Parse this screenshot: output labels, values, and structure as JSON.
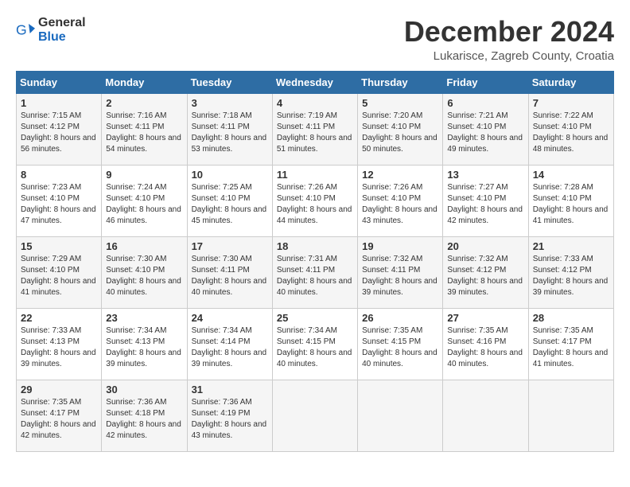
{
  "logo": {
    "text_general": "General",
    "text_blue": "Blue"
  },
  "title": "December 2024",
  "subtitle": "Lukarisce, Zagreb County, Croatia",
  "days_of_week": [
    "Sunday",
    "Monday",
    "Tuesday",
    "Wednesday",
    "Thursday",
    "Friday",
    "Saturday"
  ],
  "weeks": [
    [
      {
        "day": 1,
        "sunrise": "7:15 AM",
        "sunset": "4:12 PM",
        "daylight": "8 hours and 56 minutes."
      },
      {
        "day": 2,
        "sunrise": "7:16 AM",
        "sunset": "4:11 PM",
        "daylight": "8 hours and 54 minutes."
      },
      {
        "day": 3,
        "sunrise": "7:18 AM",
        "sunset": "4:11 PM",
        "daylight": "8 hours and 53 minutes."
      },
      {
        "day": 4,
        "sunrise": "7:19 AM",
        "sunset": "4:11 PM",
        "daylight": "8 hours and 51 minutes."
      },
      {
        "day": 5,
        "sunrise": "7:20 AM",
        "sunset": "4:10 PM",
        "daylight": "8 hours and 50 minutes."
      },
      {
        "day": 6,
        "sunrise": "7:21 AM",
        "sunset": "4:10 PM",
        "daylight": "8 hours and 49 minutes."
      },
      {
        "day": 7,
        "sunrise": "7:22 AM",
        "sunset": "4:10 PM",
        "daylight": "8 hours and 48 minutes."
      }
    ],
    [
      {
        "day": 8,
        "sunrise": "7:23 AM",
        "sunset": "4:10 PM",
        "daylight": "8 hours and 47 minutes."
      },
      {
        "day": 9,
        "sunrise": "7:24 AM",
        "sunset": "4:10 PM",
        "daylight": "8 hours and 46 minutes."
      },
      {
        "day": 10,
        "sunrise": "7:25 AM",
        "sunset": "4:10 PM",
        "daylight": "8 hours and 45 minutes."
      },
      {
        "day": 11,
        "sunrise": "7:26 AM",
        "sunset": "4:10 PM",
        "daylight": "8 hours and 44 minutes."
      },
      {
        "day": 12,
        "sunrise": "7:26 AM",
        "sunset": "4:10 PM",
        "daylight": "8 hours and 43 minutes."
      },
      {
        "day": 13,
        "sunrise": "7:27 AM",
        "sunset": "4:10 PM",
        "daylight": "8 hours and 42 minutes."
      },
      {
        "day": 14,
        "sunrise": "7:28 AM",
        "sunset": "4:10 PM",
        "daylight": "8 hours and 41 minutes."
      }
    ],
    [
      {
        "day": 15,
        "sunrise": "7:29 AM",
        "sunset": "4:10 PM",
        "daylight": "8 hours and 41 minutes."
      },
      {
        "day": 16,
        "sunrise": "7:30 AM",
        "sunset": "4:10 PM",
        "daylight": "8 hours and 40 minutes."
      },
      {
        "day": 17,
        "sunrise": "7:30 AM",
        "sunset": "4:11 PM",
        "daylight": "8 hours and 40 minutes."
      },
      {
        "day": 18,
        "sunrise": "7:31 AM",
        "sunset": "4:11 PM",
        "daylight": "8 hours and 40 minutes."
      },
      {
        "day": 19,
        "sunrise": "7:32 AM",
        "sunset": "4:11 PM",
        "daylight": "8 hours and 39 minutes."
      },
      {
        "day": 20,
        "sunrise": "7:32 AM",
        "sunset": "4:12 PM",
        "daylight": "8 hours and 39 minutes."
      },
      {
        "day": 21,
        "sunrise": "7:33 AM",
        "sunset": "4:12 PM",
        "daylight": "8 hours and 39 minutes."
      }
    ],
    [
      {
        "day": 22,
        "sunrise": "7:33 AM",
        "sunset": "4:13 PM",
        "daylight": "8 hours and 39 minutes."
      },
      {
        "day": 23,
        "sunrise": "7:34 AM",
        "sunset": "4:13 PM",
        "daylight": "8 hours and 39 minutes."
      },
      {
        "day": 24,
        "sunrise": "7:34 AM",
        "sunset": "4:14 PM",
        "daylight": "8 hours and 39 minutes."
      },
      {
        "day": 25,
        "sunrise": "7:34 AM",
        "sunset": "4:15 PM",
        "daylight": "8 hours and 40 minutes."
      },
      {
        "day": 26,
        "sunrise": "7:35 AM",
        "sunset": "4:15 PM",
        "daylight": "8 hours and 40 minutes."
      },
      {
        "day": 27,
        "sunrise": "7:35 AM",
        "sunset": "4:16 PM",
        "daylight": "8 hours and 40 minutes."
      },
      {
        "day": 28,
        "sunrise": "7:35 AM",
        "sunset": "4:17 PM",
        "daylight": "8 hours and 41 minutes."
      }
    ],
    [
      {
        "day": 29,
        "sunrise": "7:35 AM",
        "sunset": "4:17 PM",
        "daylight": "8 hours and 42 minutes."
      },
      {
        "day": 30,
        "sunrise": "7:36 AM",
        "sunset": "4:18 PM",
        "daylight": "8 hours and 42 minutes."
      },
      {
        "day": 31,
        "sunrise": "7:36 AM",
        "sunset": "4:19 PM",
        "daylight": "8 hours and 43 minutes."
      },
      null,
      null,
      null,
      null
    ]
  ]
}
